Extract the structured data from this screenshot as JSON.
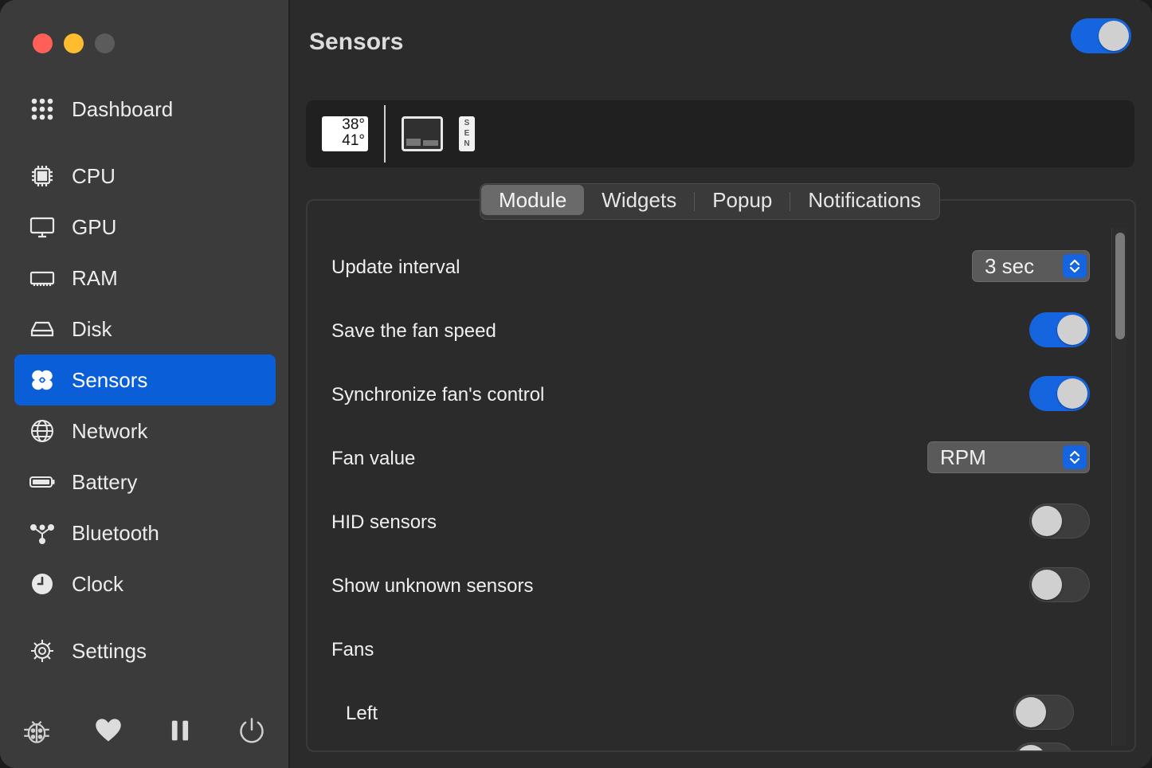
{
  "window": {
    "traffic": [
      "close",
      "minimize",
      "zoom"
    ]
  },
  "sidebar": {
    "items": [
      {
        "label": "Dashboard",
        "icon": "grid-icon"
      },
      {
        "label": "CPU",
        "icon": "cpu-icon"
      },
      {
        "label": "GPU",
        "icon": "monitor-icon"
      },
      {
        "label": "RAM",
        "icon": "ram-icon"
      },
      {
        "label": "Disk",
        "icon": "disk-icon"
      },
      {
        "label": "Sensors",
        "icon": "fan-icon",
        "active": true
      },
      {
        "label": "Network",
        "icon": "globe-icon"
      },
      {
        "label": "Battery",
        "icon": "battery-icon"
      },
      {
        "label": "Bluetooth",
        "icon": "bluetooth-icon"
      },
      {
        "label": "Clock",
        "icon": "clock-icon"
      },
      {
        "label": "Settings",
        "icon": "gear-icon"
      }
    ],
    "bottom": [
      "bug-icon",
      "heart-icon",
      "pause-icon",
      "power-icon"
    ]
  },
  "header": {
    "title": "Sensors",
    "module_enabled": true
  },
  "widgets": {
    "temp_top": "38°",
    "temp_bottom": "41°",
    "sen_label": [
      "S",
      "E",
      "N"
    ]
  },
  "tabs": [
    {
      "label": "Module",
      "selected": true
    },
    {
      "label": "Widgets"
    },
    {
      "label": "Popup"
    },
    {
      "label": "Notifications"
    }
  ],
  "settings": {
    "update_interval": {
      "label": "Update interval",
      "value": "3 sec"
    },
    "save_fan_speed": {
      "label": "Save the fan speed",
      "on": true
    },
    "sync_fan_control": {
      "label": "Synchronize fan's control",
      "on": true
    },
    "fan_value": {
      "label": "Fan value",
      "value": "RPM"
    },
    "hid_sensors": {
      "label": "HID sensors",
      "on": false
    },
    "show_unknown": {
      "label": "Show unknown sensors",
      "on": false
    },
    "fans_header": "Fans",
    "fan_left": {
      "label": "Left",
      "on": false
    }
  },
  "colors": {
    "accent": "#1565e0",
    "sidebar_active": "#0a5fd9"
  }
}
